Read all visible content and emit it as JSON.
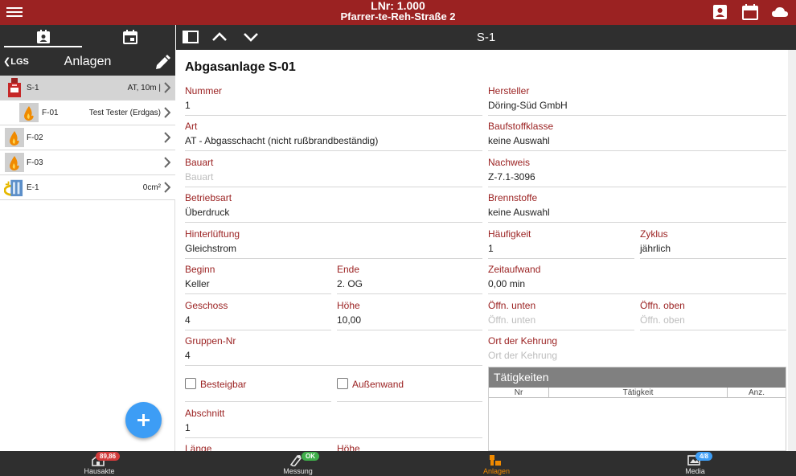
{
  "header": {
    "title_line1": "LNr: 1.000",
    "title_line2": "Pfarrer-te-Reh-Straße 2",
    "color": "#9b2222",
    "icons": [
      "menu-icon",
      "contact-card-icon",
      "calendar-icon",
      "cloud-icon"
    ]
  },
  "left_panel": {
    "back_label": "LGS",
    "title": "Anlagen",
    "rows": [
      {
        "name": "S-1",
        "value": "AT, 10m |",
        "icon": "chimney-icon",
        "selected": true
      },
      {
        "name": "F-01",
        "value": "Test Tester (Erdgas)",
        "icon": "flame-icon",
        "selected": false
      },
      {
        "name": "F-02",
        "value": "",
        "icon": "flame-icon",
        "selected": false
      },
      {
        "name": "F-03",
        "value": "",
        "icon": "flame-icon",
        "selected": false
      },
      {
        "name": "E-1",
        "value": "0cm²",
        "icon": "vent-icon",
        "selected": false
      }
    ]
  },
  "toolbar": {
    "title": "S-1"
  },
  "main": {
    "title": "Abgasanlage S-01",
    "fields": {
      "nummer": {
        "label": "Nummer",
        "value": "1"
      },
      "hersteller": {
        "label": "Hersteller",
        "value": "Döring-Süd GmbH"
      },
      "art": {
        "label": "Art",
        "value": "AT - Abgasschacht (nicht rußbrandbeständig)"
      },
      "baustoffklasse": {
        "label": "Baufstoffklasse",
        "value": "keine Auswahl"
      },
      "bauart": {
        "label": "Bauart",
        "placeholder": "Bauart"
      },
      "nachweis": {
        "label": "Nachweis",
        "value": "Z-7.1-3096"
      },
      "betriebsart": {
        "label": "Betriebsart",
        "value": "Überdruck"
      },
      "brennstoffe": {
        "label": "Brennstoffe",
        "value": "keine Auswahl"
      },
      "hinterlueftung": {
        "label": "Hinterlüftung",
        "value": "Gleichstrom"
      },
      "haeufigkeit": {
        "label": "Häufigkeit",
        "value": "1"
      },
      "zyklus": {
        "label": "Zyklus",
        "value": "jährlich"
      },
      "beginn": {
        "label": "Beginn",
        "value": "Keller"
      },
      "ende": {
        "label": "Ende",
        "value": "2. OG"
      },
      "zeitaufwand": {
        "label": "Zeitaufwand",
        "value": "0,00 min"
      },
      "geschoss": {
        "label": "Geschoss",
        "value": "4"
      },
      "hoehe": {
        "label": "Höhe",
        "value": "10,00"
      },
      "oeffn_unten": {
        "label": "Öffn. unten",
        "placeholder": "Öffn. unten"
      },
      "oeffn_oben": {
        "label": "Öffn. oben",
        "placeholder": "Öffn. oben"
      },
      "gruppen_nr": {
        "label": "Gruppen-Nr",
        "value": "4"
      },
      "ort_kehrung": {
        "label": "Ort der Kehrung",
        "placeholder": "Ort der Kehrung"
      },
      "abschnitt": {
        "label": "Abschnitt",
        "value": "1"
      },
      "laenge": {
        "label": "Länge"
      },
      "hoehe2": {
        "label": "Höhe"
      }
    },
    "checkboxes": {
      "besteigbar": {
        "label": "Besteigbar",
        "checked": false
      },
      "aussenwand": {
        "label": "Außenwand",
        "checked": false
      }
    },
    "taetigkeiten": {
      "title": "Tätigkeiten",
      "columns": [
        "Nr",
        "Tätigkeit",
        "Anz."
      ]
    }
  },
  "bottom_nav": {
    "items": [
      {
        "label": "Hausakte",
        "badge": "89,86",
        "badge_color": "#d23a3a",
        "icon": "house-file-icon"
      },
      {
        "label": "Messung",
        "badge": "OK",
        "badge_color": "#3fae4a",
        "icon": "measurement-icon"
      },
      {
        "label": "Anlagen",
        "badge": "",
        "badge_color": "",
        "icon": "installations-icon",
        "active": true
      },
      {
        "label": "Media",
        "badge": "4/8",
        "badge_color": "#3d9df5",
        "icon": "media-icon"
      }
    ],
    "active_color": "#f08a00"
  }
}
